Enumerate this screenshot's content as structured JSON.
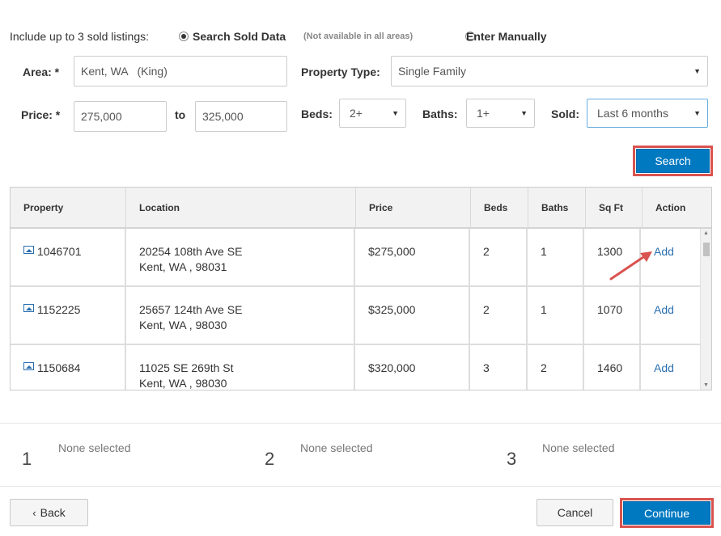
{
  "source_selector": {
    "label": "Include up to 3 sold listings:",
    "option_search": "Search Sold Data",
    "note": "(Not available in all areas)",
    "option_manual": "Enter Manually",
    "selected": "Search Sold Data"
  },
  "filters": {
    "area_label": "Area: *",
    "area_value": "Kent, WA   (King)",
    "property_type_label": "Property Type:",
    "property_type_value": "Single Family",
    "price_label": "Price: *",
    "price_min": "275,000",
    "price_to": "to",
    "price_max": "325,000",
    "beds_label": "Beds:",
    "beds_value": "2+",
    "baths_label": "Baths:",
    "baths_value": "1+",
    "sold_label": "Sold:",
    "sold_value": "Last 6 months",
    "search_button": "Search"
  },
  "table": {
    "headers": [
      "Property",
      "Location",
      "Price",
      "Beds",
      "Baths",
      "Sq Ft",
      "Action"
    ],
    "rows": [
      {
        "id": "1046701",
        "address": "20254 108th Ave SE",
        "city": "Kent, WA , 98031",
        "price": "$275,000",
        "beds": "2",
        "baths": "1",
        "sqft": "1300",
        "action": "Add"
      },
      {
        "id": "1152225",
        "address": "25657 124th Ave SE",
        "city": "Kent, WA , 98030",
        "price": "$325,000",
        "beds": "2",
        "baths": "1",
        "sqft": "1070",
        "action": "Add"
      },
      {
        "id": "1150684",
        "address": "11025 SE 269th St",
        "city": "Kent, WA , 98030",
        "price": "$320,000",
        "beds": "3",
        "baths": "2",
        "sqft": "1460",
        "action": "Add"
      }
    ]
  },
  "selections": [
    {
      "number": "1",
      "text": "None selected"
    },
    {
      "number": "2",
      "text": "None selected"
    },
    {
      "number": "3",
      "text": "None selected"
    }
  ],
  "footer": {
    "back_chevron": "‹",
    "back_label": "Back",
    "cancel_label": "Cancel",
    "continue_label": "Continue"
  },
  "colors": {
    "primary": "#0079c1",
    "highlight_frame": "#d9534f",
    "link": "#2a6fb0"
  }
}
